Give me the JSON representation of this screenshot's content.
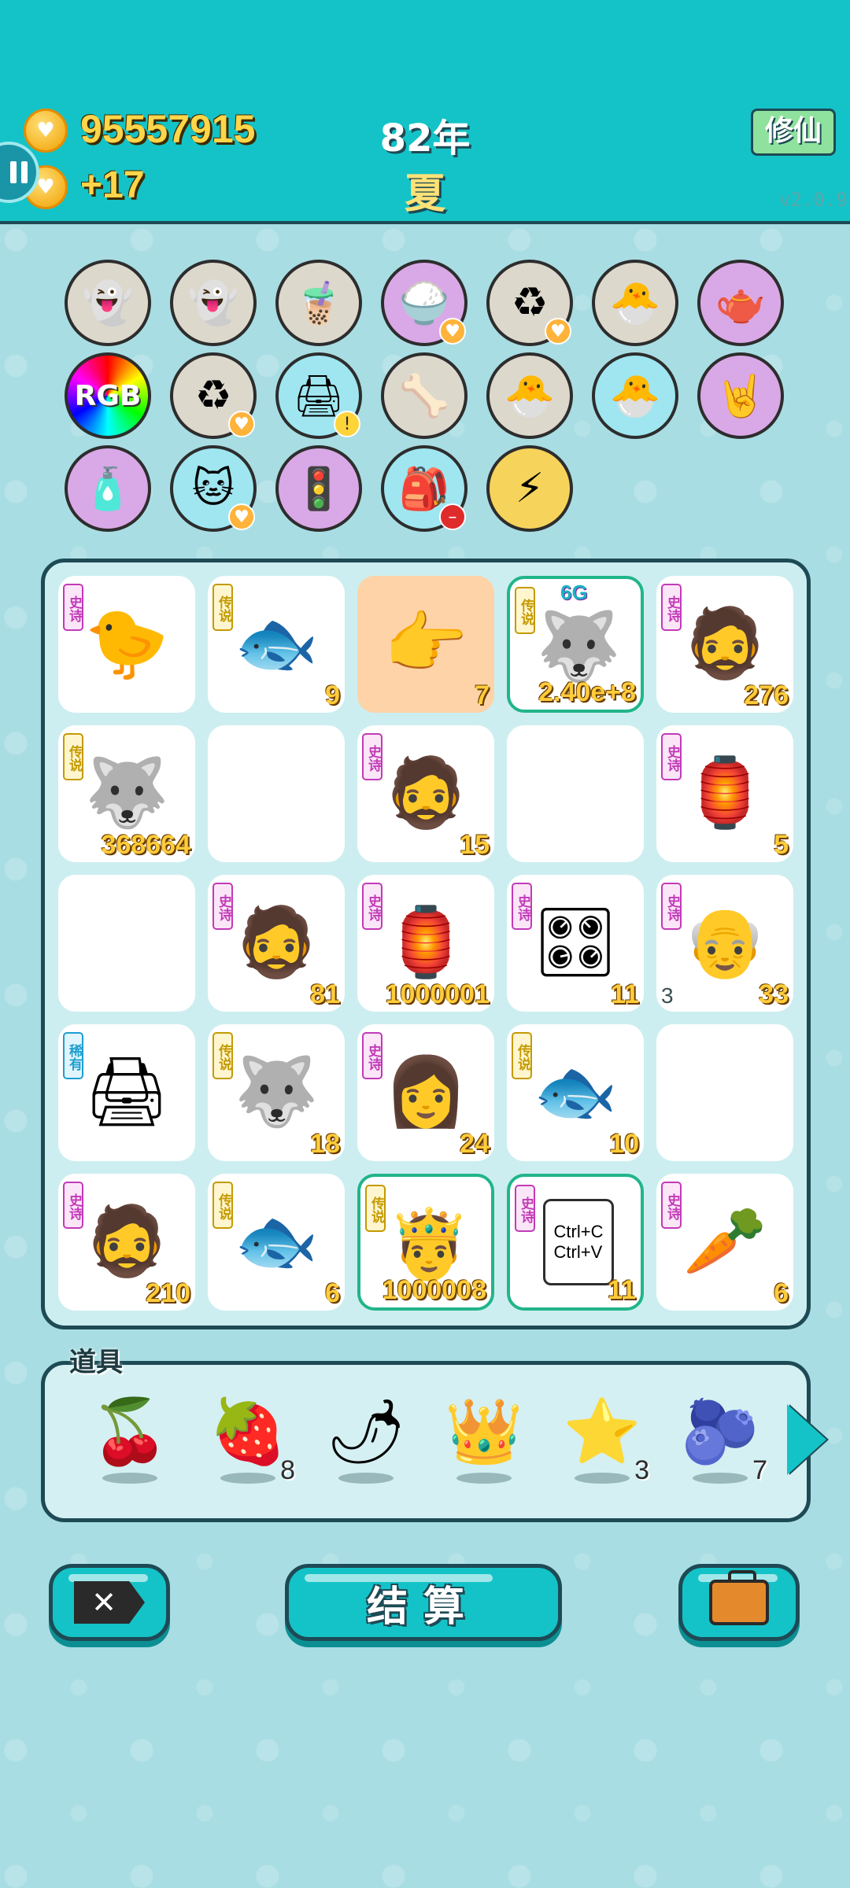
{
  "header": {
    "money": "95557915",
    "money_rate": "+17",
    "year": "82年",
    "season": "夏",
    "cultivate_label": "修仙",
    "version": "v2.0.9"
  },
  "upgrades": [
    {
      "name": "ghost-1",
      "icon": "👻",
      "color": "gray",
      "tag": ""
    },
    {
      "name": "ghost-2",
      "icon": "👻",
      "color": "gray",
      "tag": ""
    },
    {
      "name": "bubble-tea",
      "icon": "🧋",
      "color": "gray",
      "tag": ""
    },
    {
      "name": "rice-bowl",
      "icon": "🍚",
      "color": "purple",
      "tag": "heart"
    },
    {
      "name": "refresh",
      "icon": "♻",
      "color": "gray",
      "tag": "heart"
    },
    {
      "name": "chick-egg",
      "icon": "🐣",
      "color": "gray",
      "tag": ""
    },
    {
      "name": "gravy-boat",
      "icon": "🫖",
      "color": "purple",
      "tag": ""
    },
    {
      "name": "rgb",
      "icon": "RGB",
      "color": "rgb",
      "tag": ""
    },
    {
      "name": "refresh-2",
      "icon": "♻",
      "color": "gray",
      "tag": "heart"
    },
    {
      "name": "printer",
      "icon": "🖨",
      "color": "blue",
      "tag": "warn"
    },
    {
      "name": "dog-food",
      "icon": "🦴",
      "color": "gray",
      "tag": ""
    },
    {
      "name": "chick-egg-2",
      "icon": "🐣",
      "color": "gray",
      "tag": ""
    },
    {
      "name": "chick-egg-3",
      "icon": "🐣",
      "color": "blue",
      "tag": ""
    },
    {
      "name": "rock-hand",
      "icon": "🤘",
      "color": "purple",
      "tag": ""
    },
    {
      "name": "spray-bottle",
      "icon": "🧴",
      "color": "purple",
      "tag": ""
    },
    {
      "name": "cat",
      "icon": "🐱",
      "color": "blue",
      "tag": "heart"
    },
    {
      "name": "traffic-ghost",
      "icon": "🚦",
      "color": "purple",
      "tag": ""
    },
    {
      "name": "sack",
      "icon": "🎒",
      "color": "blue",
      "tag": "minus"
    },
    {
      "name": "lightning",
      "icon": "⚡",
      "color": "yellow",
      "tag": ""
    }
  ],
  "rarity_labels": {
    "epic": "史诗",
    "legend": "传说",
    "rare": "稀有"
  },
  "board": [
    {
      "rarity": "epic",
      "icon": "🐤",
      "count": "",
      "name": "silver-hair-chick"
    },
    {
      "rarity": "legend",
      "icon": "🐟",
      "count": "9",
      "name": "koi-fish"
    },
    {
      "rarity": "",
      "icon": "👉",
      "count": "7",
      "name": "pointing-hand",
      "orange": true
    },
    {
      "rarity": "legend",
      "icon": "🐺",
      "count": "2.40e+8",
      "name": "husky-king",
      "hl": true,
      "badge": "6G"
    },
    {
      "rarity": "epic",
      "icon": "🧔",
      "count": "276",
      "name": "green-hat-man"
    },
    {
      "rarity": "legend",
      "icon": "🐺",
      "count": "368664",
      "name": "husky-crown"
    },
    {
      "rarity": "",
      "icon": "",
      "count": "",
      "name": "empty"
    },
    {
      "rarity": "epic",
      "icon": "🧔",
      "count": "15",
      "name": "green-hat-man"
    },
    {
      "rarity": "",
      "icon": "",
      "count": "",
      "name": "empty"
    },
    {
      "rarity": "epic",
      "icon": "🏮",
      "count": "5",
      "name": "rabbit-house"
    },
    {
      "rarity": "",
      "icon": "",
      "count": "",
      "name": "empty"
    },
    {
      "rarity": "epic",
      "icon": "🧔",
      "count": "81",
      "name": "pink-glasses-man"
    },
    {
      "rarity": "epic",
      "icon": "🏮",
      "count": "1000001",
      "name": "rabbit-house"
    },
    {
      "rarity": "epic",
      "icon": "🎛",
      "count": "11",
      "name": "graphics-card"
    },
    {
      "rarity": "epic",
      "icon": "👴",
      "count": "33",
      "name": "old-man",
      "lvl": "3"
    },
    {
      "rarity": "rare",
      "icon": "🖨",
      "count": "",
      "name": "printer"
    },
    {
      "rarity": "legend",
      "icon": "🐺",
      "count": "18",
      "name": "husky-crown"
    },
    {
      "rarity": "epic",
      "icon": "👩",
      "count": "24",
      "name": "braided-girl"
    },
    {
      "rarity": "legend",
      "icon": "🐟",
      "count": "10",
      "name": "koi-fish"
    },
    {
      "rarity": "",
      "icon": "",
      "count": "",
      "name": "empty"
    },
    {
      "rarity": "epic",
      "icon": "🧔",
      "count": "210",
      "name": "green-hat-man"
    },
    {
      "rarity": "legend",
      "icon": "🐟",
      "count": "6",
      "name": "koi-fish"
    },
    {
      "rarity": "legend",
      "icon": "🤴",
      "count": "1000008",
      "name": "golden-king",
      "hl": true
    },
    {
      "rarity": "epic",
      "icon": "📋",
      "count": "11",
      "name": "copy-paste",
      "hl": true,
      "text": "Ctrl+C\nCtrl+V"
    },
    {
      "rarity": "epic",
      "icon": "🥕",
      "count": "6",
      "name": "carrot"
    }
  ],
  "props": {
    "title": "道具",
    "items": [
      {
        "name": "lychee",
        "icon": "🍒",
        "count": ""
      },
      {
        "name": "strawberry",
        "icon": "🍓",
        "count": "8"
      },
      {
        "name": "chili",
        "icon": "🌶",
        "count": ""
      },
      {
        "name": "crown",
        "icon": "👑",
        "count": ""
      },
      {
        "name": "star",
        "icon": "⭐",
        "count": "3"
      },
      {
        "name": "blueberry",
        "icon": "🫐",
        "count": "7"
      }
    ]
  },
  "buttons": {
    "close_icon": "✕",
    "settle_label": "结算",
    "bag_icon": "briefcase-icon"
  }
}
